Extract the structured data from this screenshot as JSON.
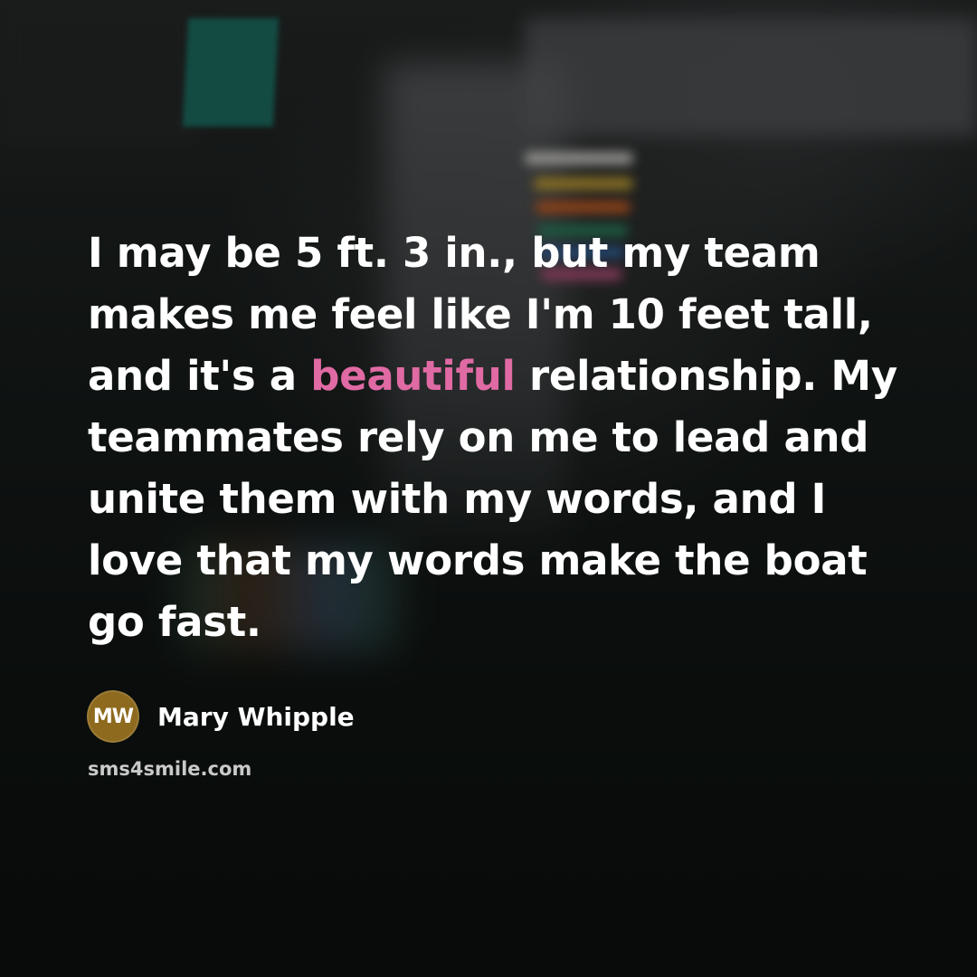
{
  "quote": {
    "before": "I may be 5 ft. 3 in., but my team makes me feel like I'm 10 feet tall, and it's a ",
    "highlight": "beautiful",
    "after": " relationship. My teammates rely on me to lead and unite them with my words, and I love that my words make the boat go fast."
  },
  "author": {
    "initials": "MW",
    "name": "Mary Whipple"
  },
  "site": {
    "url": "sms4smile.com"
  },
  "colors": {
    "highlight": "#e06aa4",
    "avatar": "#8e6a1e",
    "text": "#ffffff",
    "site_text": "#c9c9c9"
  }
}
